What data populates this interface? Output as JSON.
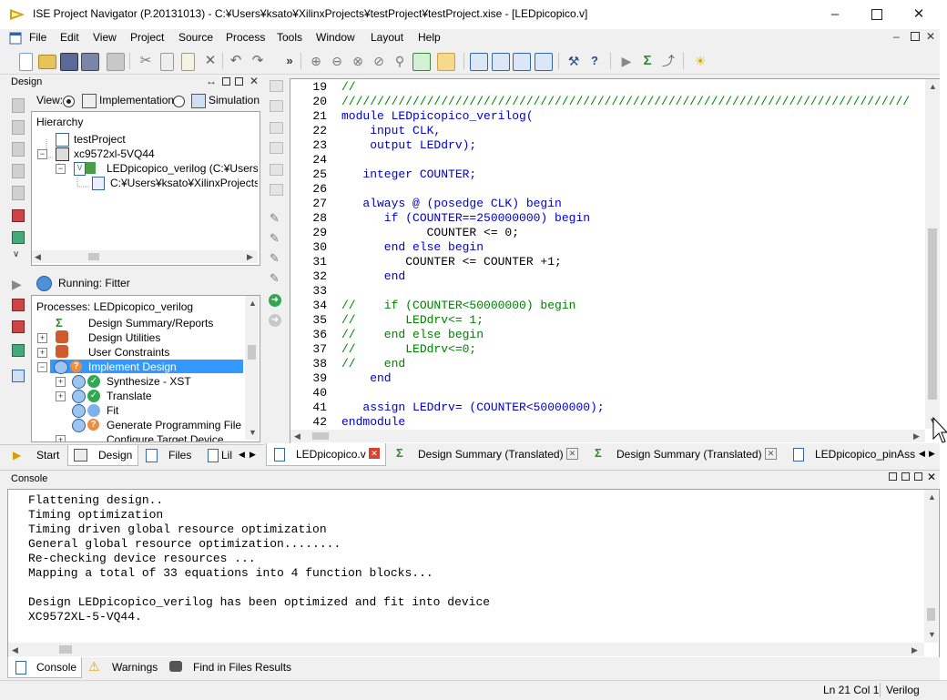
{
  "window": {
    "title": "ISE Project Navigator (P.20131013) - C:¥Users¥ksato¥XilinxProjects¥testProject¥testProject.xise - [LEDpicopico.v]"
  },
  "menu": [
    "File",
    "Edit",
    "View",
    "Project",
    "Source",
    "Process",
    "Tools",
    "Window",
    "Layout",
    "Help"
  ],
  "design_panel": {
    "title": "Design",
    "view_label": "View:",
    "view_implementation": "Implementation",
    "view_simulation": "Simulation",
    "hierarchy_label": "Hierarchy",
    "tree": [
      {
        "label": "testProject"
      },
      {
        "label": "xc9572xl-5VQ44"
      },
      {
        "label": "LEDpicopico_verilog (C:¥Users¥k"
      },
      {
        "label": "C:¥Users¥ksato¥XilinxProjects¥t"
      }
    ]
  },
  "running": {
    "label": "Running: Fitter"
  },
  "processes": {
    "title": "Processes: LEDpicopico_verilog",
    "items": [
      {
        "label": "Design Summary/Reports"
      },
      {
        "label": "Design Utilities"
      },
      {
        "label": "User Constraints"
      },
      {
        "label": "Implement Design"
      },
      {
        "label": "Synthesize - XST"
      },
      {
        "label": "Translate"
      },
      {
        "label": "Fit"
      },
      {
        "label": "Generate Programming File"
      },
      {
        "label": "Configure Target Device"
      }
    ]
  },
  "left_tabs": [
    "Start",
    "Design",
    "Files",
    "Lil"
  ],
  "editor": {
    "lines": [
      {
        "n": "19",
        "t": "//"
      },
      {
        "n": "20",
        "t": "////////////////////////////////////////////////////////////////////////////////"
      },
      {
        "n": "21",
        "t": "module LEDpicopico_verilog("
      },
      {
        "n": "22",
        "t": "    input CLK,"
      },
      {
        "n": "23",
        "t": "    output LEDdrv);"
      },
      {
        "n": "24",
        "t": ""
      },
      {
        "n": "25",
        "t": "   integer COUNTER;"
      },
      {
        "n": "26",
        "t": ""
      },
      {
        "n": "27",
        "t": "   always @ (posedge CLK) begin"
      },
      {
        "n": "28",
        "t": "      if (COUNTER==250000000) begin"
      },
      {
        "n": "29",
        "t": "            COUNTER <= 0;"
      },
      {
        "n": "30",
        "t": "      end else begin"
      },
      {
        "n": "31",
        "t": "         COUNTER <= COUNTER +1;"
      },
      {
        "n": "32",
        "t": "      end"
      },
      {
        "n": "33",
        "t": ""
      },
      {
        "n": "34",
        "t": "//    if (COUNTER<50000000) begin"
      },
      {
        "n": "35",
        "t": "//       LEDdrv<= 1;"
      },
      {
        "n": "36",
        "t": "//    end else begin"
      },
      {
        "n": "37",
        "t": "//       LEDdrv<=0;"
      },
      {
        "n": "38",
        "t": "//    end"
      },
      {
        "n": "39",
        "t": "    end"
      },
      {
        "n": "40",
        "t": ""
      },
      {
        "n": "41",
        "t": "   assign LEDdrv= (COUNTER<50000000);"
      },
      {
        "n": "42",
        "t": "endmodule"
      }
    ],
    "tabs": [
      {
        "label": "LEDpicopico.v",
        "active": true
      },
      {
        "label": "Design Summary (Translated)"
      },
      {
        "label": "Design Summary (Translated)"
      },
      {
        "label": "LEDpicopico_pinAssi"
      }
    ]
  },
  "console": {
    "title": "Console",
    "lines": [
      "Flattening design..",
      "Timing optimization",
      "Timing driven global resource optimization",
      "General global resource optimization........",
      "Re-checking device resources ...",
      "Mapping a total of 33 equations into 4 function blocks...",
      "",
      "Design LEDpicopico_verilog has been optimized and fit into device",
      "XC9572XL-5-VQ44."
    ],
    "tabs": [
      "Console",
      "Warnings",
      "Find in Files Results"
    ]
  },
  "status": {
    "position": "Ln 21 Col 1",
    "language": "Verilog"
  },
  "colors": {
    "selection": "#3399ff",
    "keyword": "#0000c8",
    "comment": "#008000"
  }
}
